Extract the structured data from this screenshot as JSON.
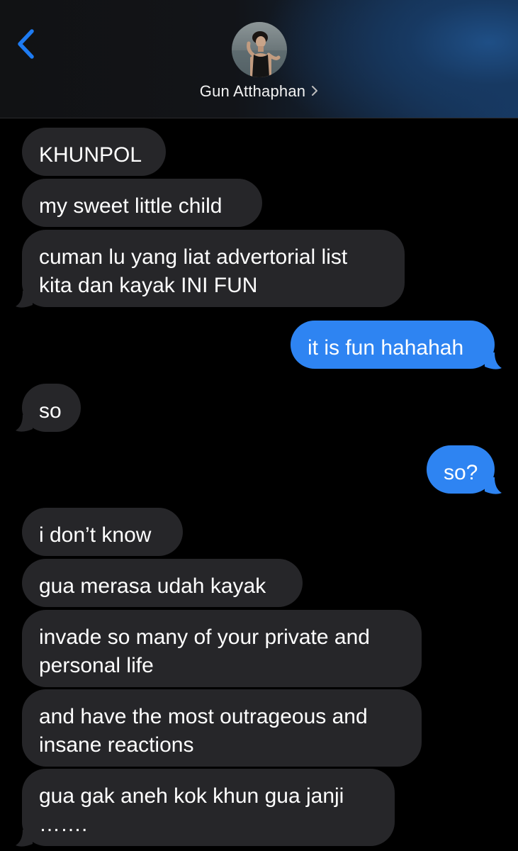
{
  "header": {
    "contact_name": "Gun Atthaphan",
    "back_icon": "chevron-left-icon",
    "name_chevron_icon": "chevron-right-icon",
    "accent_color": "#1e7bf2"
  },
  "messages": [
    {
      "direction": "incoming",
      "lines": [
        "KHUNPOL"
      ]
    },
    {
      "direction": "incoming",
      "lines": [
        "my sweet little child"
      ]
    },
    {
      "direction": "incoming",
      "lines": [
        "cuman lu yang liat advertorial list",
        "kita dan kayak INI FUN"
      ]
    },
    {
      "direction": "outgoing",
      "lines": [
        "it is fun hahahah"
      ]
    },
    {
      "direction": "incoming",
      "lines": [
        "so"
      ]
    },
    {
      "direction": "outgoing",
      "lines": [
        "so?"
      ]
    },
    {
      "direction": "incoming",
      "lines": [
        "i don’t know"
      ]
    },
    {
      "direction": "incoming",
      "lines": [
        "gua merasa udah kayak"
      ]
    },
    {
      "direction": "incoming",
      "lines": [
        "invade so many of your private and",
        "personal life"
      ]
    },
    {
      "direction": "incoming",
      "lines": [
        "and have the most outrageous and",
        "insane reactions"
      ]
    },
    {
      "direction": "incoming",
      "lines": [
        "gua gak aneh kok khun gua janji",
        "……."
      ]
    }
  ],
  "colors": {
    "incoming_bubble": "#262629",
    "outgoing_bubble": "#2e84f2",
    "background": "#000000"
  }
}
